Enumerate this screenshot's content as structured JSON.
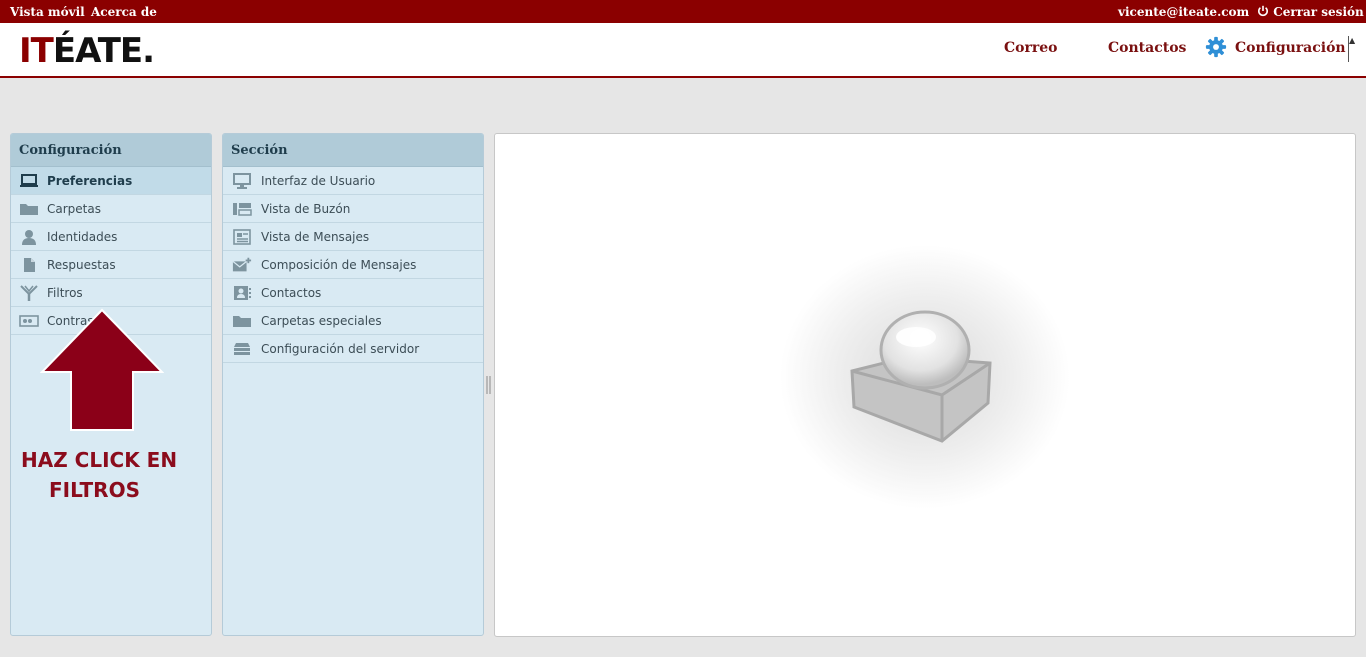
{
  "topbar": {
    "mobile_view": "Vista móvil",
    "about": "Acerca de",
    "user_email": "vicente@iteate.com",
    "logout": "Cerrar sesión"
  },
  "header": {
    "logo_red": "IT",
    "logo_rest": "ÉATE.",
    "nav_mail": "Correo",
    "nav_contacts": "Contactos",
    "nav_settings": "Configuración"
  },
  "config_panel": {
    "title": "Configuración",
    "items": [
      {
        "label": "Preferencias",
        "icon": "laptop-icon"
      },
      {
        "label": "Carpetas",
        "icon": "folder-icon"
      },
      {
        "label": "Identidades",
        "icon": "person-icon"
      },
      {
        "label": "Respuestas",
        "icon": "document-icon"
      },
      {
        "label": "Filtros",
        "icon": "filter-icon"
      },
      {
        "label": "Contras",
        "icon": "password-icon"
      }
    ]
  },
  "section_panel": {
    "title": "Sección",
    "items": [
      {
        "label": "Interfaz de Usuario",
        "icon": "monitor-icon"
      },
      {
        "label": "Vista de Buzón",
        "icon": "mailbox-view-icon"
      },
      {
        "label": "Vista de Mensajes",
        "icon": "message-view-icon"
      },
      {
        "label": "Composición de Mensajes",
        "icon": "compose-icon"
      },
      {
        "label": "Contactos",
        "icon": "contact-card-icon"
      },
      {
        "label": "Carpetas especiales",
        "icon": "folder-icon"
      },
      {
        "label": "Configuración del servidor",
        "icon": "server-icon"
      }
    ]
  },
  "annotation": {
    "line1": "HAZ CLICK EN",
    "line2": "FILTROS"
  },
  "colors": {
    "brand": "#8b0000",
    "panel_bg": "#d9eaf3",
    "panel_header": "#b0cbd8",
    "annotation": "#8b0c1c",
    "gear": "#2f8fd6"
  }
}
